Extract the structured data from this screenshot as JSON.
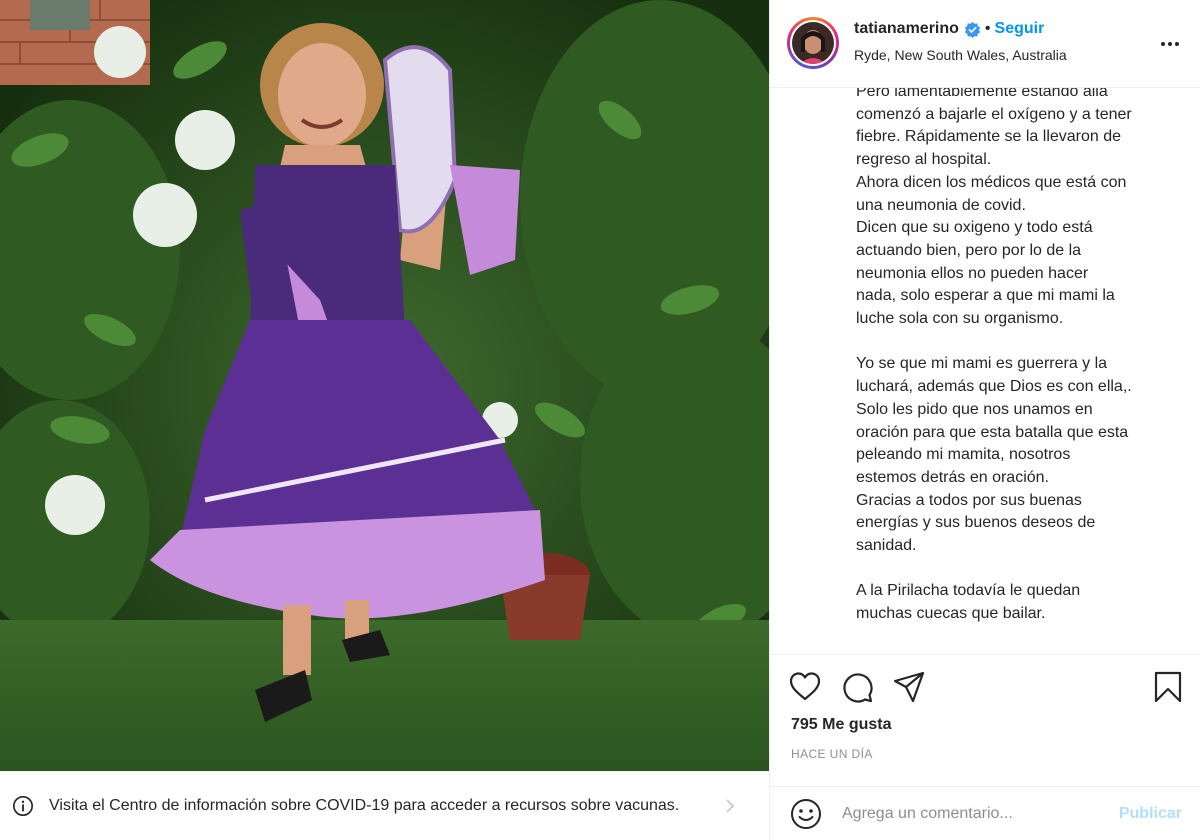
{
  "post": {
    "username": "tatianamerino",
    "separator": "•",
    "follow_label": "Seguir",
    "location": "Ryde, New South Wales, Australia",
    "caption_lines": [
      "Pero lamentablemente estando allá",
      "comenzó a bajarle el oxígeno y a tener",
      "fiebre. Rápidamente se la llevaron de",
      "regreso al hospital.",
      "Ahora dicen los médicos que está con",
      "una neumonia de covid.",
      "Dicen que su oxigeno y todo está",
      "actuando bien, pero por lo de la",
      "neumonia ellos no pueden hacer",
      "nada, solo esperar a que mi mami la",
      "luche sola con su organismo.",
      "",
      "Yo se que mi mami es guerrera y la",
      "luchará, además que Dios es con ella,.",
      "Solo les pido que nos unamos en",
      "oración para que esta batalla que esta",
      "peleando mi mamita, nosotros",
      "estemos detrás en oración.",
      "Gracias a todos por sus buenas",
      "energías y sus buenos deseos de",
      "sanidad.",
      "",
      "A la Pirilacha todavía le quedan",
      "muchas cuecas que bailar."
    ],
    "likes": "795 Me gusta",
    "timestamp": "HACE UN DÍA"
  },
  "comment": {
    "placeholder": "Agrega un comentario...",
    "publish_label": "Publicar"
  },
  "banner": {
    "text": "Visita el Centro de información sobre COVID-19 para acceder a recursos sobre vacunas."
  },
  "icons": {
    "verified": "verified-badge-icon",
    "more": "more-options-icon",
    "like": "heart-icon",
    "comment": "comment-icon",
    "share": "send-icon",
    "save": "bookmark-icon",
    "emoji": "emoji-icon",
    "info": "info-icon",
    "chevron": "chevron-right-icon"
  },
  "colors": {
    "accent": "#0095f6",
    "publish_disabled": "#b2dffc",
    "muted": "#8e8e8e",
    "text": "#262626"
  }
}
